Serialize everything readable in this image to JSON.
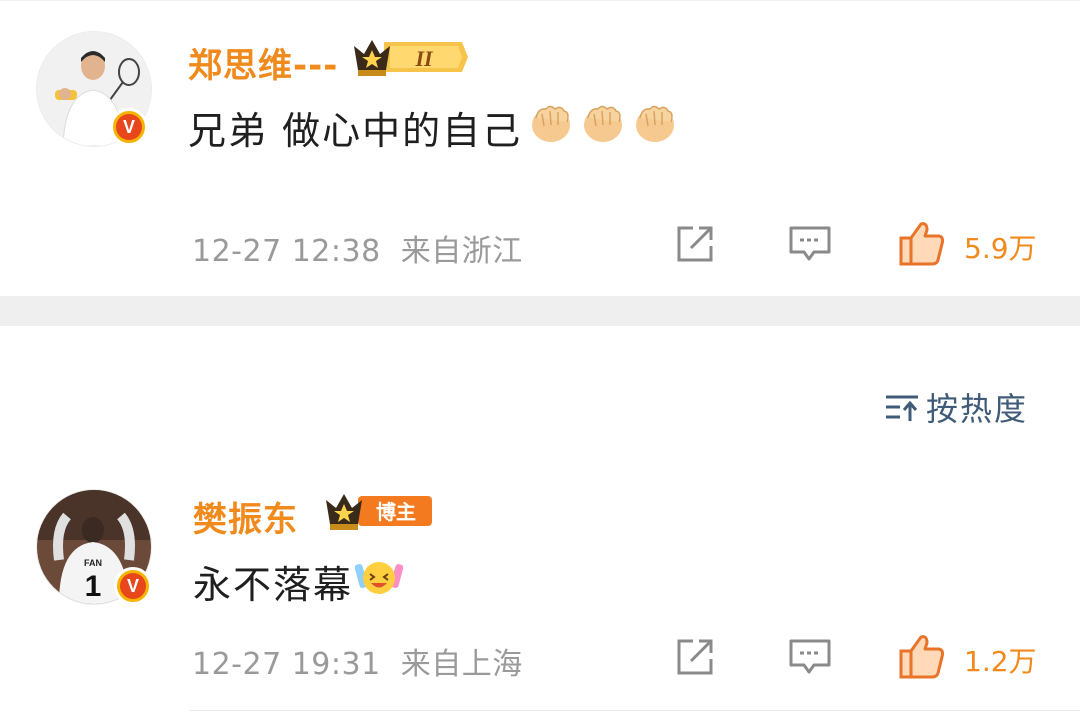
{
  "comments": [
    {
      "username": "郑思维---",
      "badge": "II",
      "text": "兄弟 做心中的自己",
      "emojis": [
        "fist-emoji",
        "fist-emoji",
        "fist-emoji"
      ],
      "time": "12-27 12:38",
      "location": "来自浙江",
      "likes": "5.9万"
    },
    {
      "username": "樊振东",
      "badge": "博主",
      "text": "永不落幕",
      "emojis": [
        "cheering-emoji"
      ],
      "time": "12-27 19:31",
      "location": "来自上海",
      "likes": "1.2万",
      "avatar_text": {
        "name": "FAN",
        "number": "1"
      }
    }
  ],
  "sort": {
    "label": "按热度"
  },
  "colors": {
    "username": "#f08a1c",
    "like": "#f08a1c",
    "meta": "#9a9a9a",
    "sort": "#3f5b78",
    "divider": "#efefef"
  }
}
